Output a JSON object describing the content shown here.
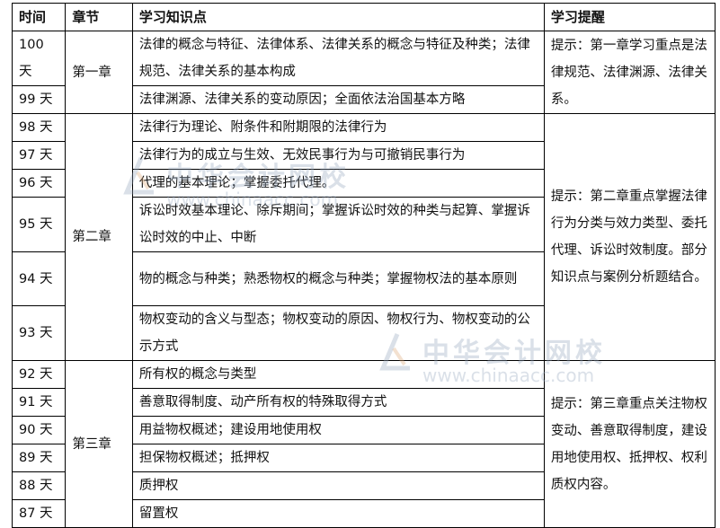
{
  "table": {
    "headers": [
      "时间",
      "章节",
      "学习知识点",
      "学习提醒"
    ],
    "chapters": [
      {
        "name": "第一章",
        "tip": "提示：第一章学习重点是法律规范、法律渊源、法律关系。",
        "rows": [
          {
            "day": "100 天",
            "topic": "法律的概念与特征、法律体系、法律关系的概念与特征及种类；法律规范、法律关系的基本构成"
          },
          {
            "day": "99 天",
            "topic": "法律渊源、法律关系的变动原因；全面依法治国基本方略"
          }
        ]
      },
      {
        "name": "第二章",
        "tip": "提示：第二章重点掌握法律行为分类与效力类型、委托代理、诉讼时效制度。部分知识点与案例分析题结合。",
        "rows": [
          {
            "day": "98 天",
            "topic": "法律行为理论、附条件和附期限的法律行为"
          },
          {
            "day": "97 天",
            "topic": "法律行为的成立与生效、无效民事行为与可撤销民事行为"
          },
          {
            "day": "96 天",
            "topic": "代理的基本理论；掌握委托代理。"
          },
          {
            "day": "95 天",
            "topic": "诉讼时效基本理论、除斥期间；掌握诉讼时效的种类与起算、掌握诉讼时效的中止、中断"
          },
          {
            "day": "94 天",
            "topic": "物的概念与种类；熟悉物权的概念与种类；掌握物权法的基本原则"
          },
          {
            "day": "93 天",
            "topic": "物权变动的含义与型态；物权变动的原因、物权行为、物权变动的公示方式"
          }
        ]
      },
      {
        "name": "第三章",
        "tip": "提示：第三章重点关注物权变动、善意取得制度，建设用地使用权、抵押权、权利质权内容。",
        "rows": [
          {
            "day": "92 天",
            "topic": "所有权的概念与类型"
          },
          {
            "day": "91 天",
            "topic": "善意取得制度、动产所有权的特殊取得方式"
          },
          {
            "day": "90 天",
            "topic": "用益物权概述；建设用地使用权"
          },
          {
            "day": "89 天",
            "topic": "担保物权概述；抵押权"
          },
          {
            "day": "88 天",
            "topic": "质押权"
          },
          {
            "day": "87 天",
            "topic": "留置权"
          }
        ]
      }
    ]
  },
  "watermark": {
    "cn": "中华会计网校",
    "en": "www.chinaacc.com"
  },
  "colors": {
    "border": "#000000",
    "watermark": "#96a5be"
  }
}
